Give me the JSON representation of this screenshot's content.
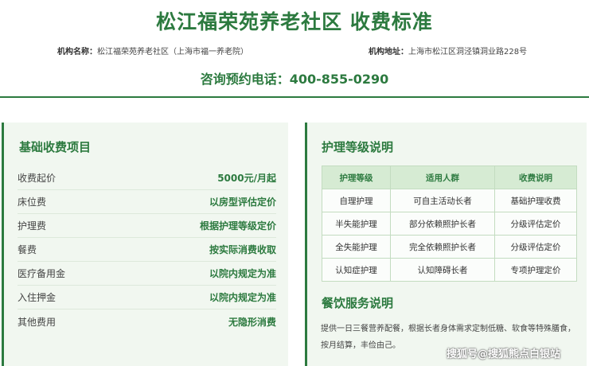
{
  "header": {
    "title": "松江福荣苑养老社区 收费标准",
    "org_name_label": "机构名称：",
    "org_name": "松江福荣苑养老社区（上海市福一养老院）",
    "org_address_label": "机构地址：",
    "org_address": "上海市松江区洞泾镇洞业路228号",
    "phone_label": "咨询预约电话：",
    "phone": "400-855-0290"
  },
  "basic_fees": {
    "title": "基础收费项目",
    "items": [
      {
        "label": "收费起价",
        "value": "5000元/月起"
      },
      {
        "label": "床位费",
        "value": "以房型评估定价"
      },
      {
        "label": "护理费",
        "value": "根据护理等级定价"
      },
      {
        "label": "餐费",
        "value": "按实际消费收取"
      },
      {
        "label": "医疗备用金",
        "value": "以院内规定为准"
      },
      {
        "label": "入住押金",
        "value": "以院内规定为准"
      },
      {
        "label": "其他费用",
        "value": "无隐形消费"
      }
    ]
  },
  "care_levels": {
    "title": "护理等级说明",
    "headers": [
      "护理等级",
      "适用人群",
      "收费说明"
    ],
    "rows": [
      [
        "自理护理",
        "可自主活动长者",
        "基础护理收费"
      ],
      [
        "半失能护理",
        "部分依赖照护长者",
        "分级评估定价"
      ],
      [
        "全失能护理",
        "完全依赖照护长者",
        "分级评估定价"
      ],
      [
        "认知症护理",
        "认知障碍长者",
        "专项护理定价"
      ]
    ]
  },
  "diet": {
    "title": "餐饮服务说明",
    "text": "提供一日三餐营养配餐，根据长者身体需求定制低糖、软食等特殊膳食，按月结算，丰俭由己。"
  },
  "watermark": "搜狐号@搜狐熊点白银站",
  "colors": {
    "accent": "#2c7a3f",
    "panel_bg": "#f1f7f0",
    "table_header_bg": "#d6ebd3"
  }
}
